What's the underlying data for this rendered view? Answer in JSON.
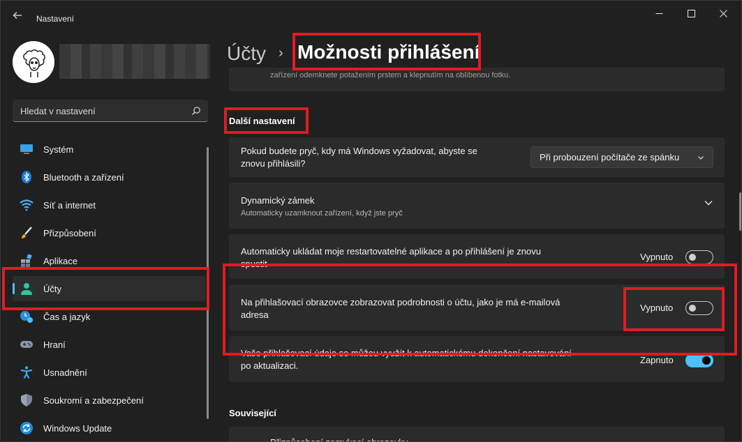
{
  "window": {
    "app_title": "Nastavení",
    "back_icon": "arrow-left-icon",
    "controls": [
      "minimize-icon",
      "maximize-icon",
      "close-icon"
    ]
  },
  "sidebar": {
    "search_placeholder": "Hledat v nastavení",
    "items": [
      {
        "label": "Systém",
        "icon": "monitor-icon",
        "active": false
      },
      {
        "label": "Bluetooth a zařízení",
        "icon": "bluetooth-icon",
        "active": false
      },
      {
        "label": "Síť a internet",
        "icon": "wifi-icon",
        "active": false
      },
      {
        "label": "Přizpůsobení",
        "icon": "brush-icon",
        "active": false
      },
      {
        "label": "Aplikace",
        "icon": "apps-icon",
        "active": false
      },
      {
        "label": "Účty",
        "icon": "person-icon",
        "active": true
      },
      {
        "label": "Čas a jazyk",
        "icon": "clock-globe-icon",
        "active": false
      },
      {
        "label": "Hraní",
        "icon": "gamepad-icon",
        "active": false
      },
      {
        "label": "Usnadnění",
        "icon": "accessibility-icon",
        "active": false
      },
      {
        "label": "Soukromí a zabezpečení",
        "icon": "shield-icon",
        "active": false
      },
      {
        "label": "Windows Update",
        "icon": "update-icon",
        "active": false
      }
    ]
  },
  "header": {
    "parent": "Účty",
    "separator": "›",
    "current": "Možnosti přihlášení"
  },
  "main": {
    "partial_card_text": "zařízení odemknete potažením prstem a klepnutím na oblíbenou fotku.",
    "section_title": "Další nastavení",
    "require_signin": {
      "text_line1": "Pokud budete pryč, kdy má Windows vyžadovat, abyste se",
      "text_line2": "znovu přihlásili?",
      "dropdown_value": "Při probouzení počítače ze spánku"
    },
    "dynamic_lock": {
      "title": "Dynamický zámek",
      "subtitle": "Automaticky uzamknout zařízení, když jste pryč"
    },
    "restart_apps": {
      "text_line1": "Automaticky ukládat moje restartovatelné aplikace a po přihlášení je znovu",
      "text_line2": "spustit",
      "state": "Vypnuto",
      "on": false
    },
    "account_details": {
      "text_line1": "Na přihlašovací obrazovce zobrazovat podrobnosti o účtu, jako je má e-mailová",
      "text_line2": "adresa",
      "state": "Vypnuto",
      "on": false
    },
    "use_signin_info": {
      "text_line1": "Vaše přihlašovací údaje se můžou využít k automatickému dokončení nastavování",
      "text_line2": "po aktualizaci.",
      "state": "Zapnuto",
      "on": true
    },
    "related_title": "Související",
    "related_partial_text": "Přizpůsobení zamykací obrazovky"
  },
  "colors": {
    "accent": "#4cc2ff",
    "annotation": "#e01b24",
    "card": "#2b2b2b",
    "background": "#202020"
  }
}
